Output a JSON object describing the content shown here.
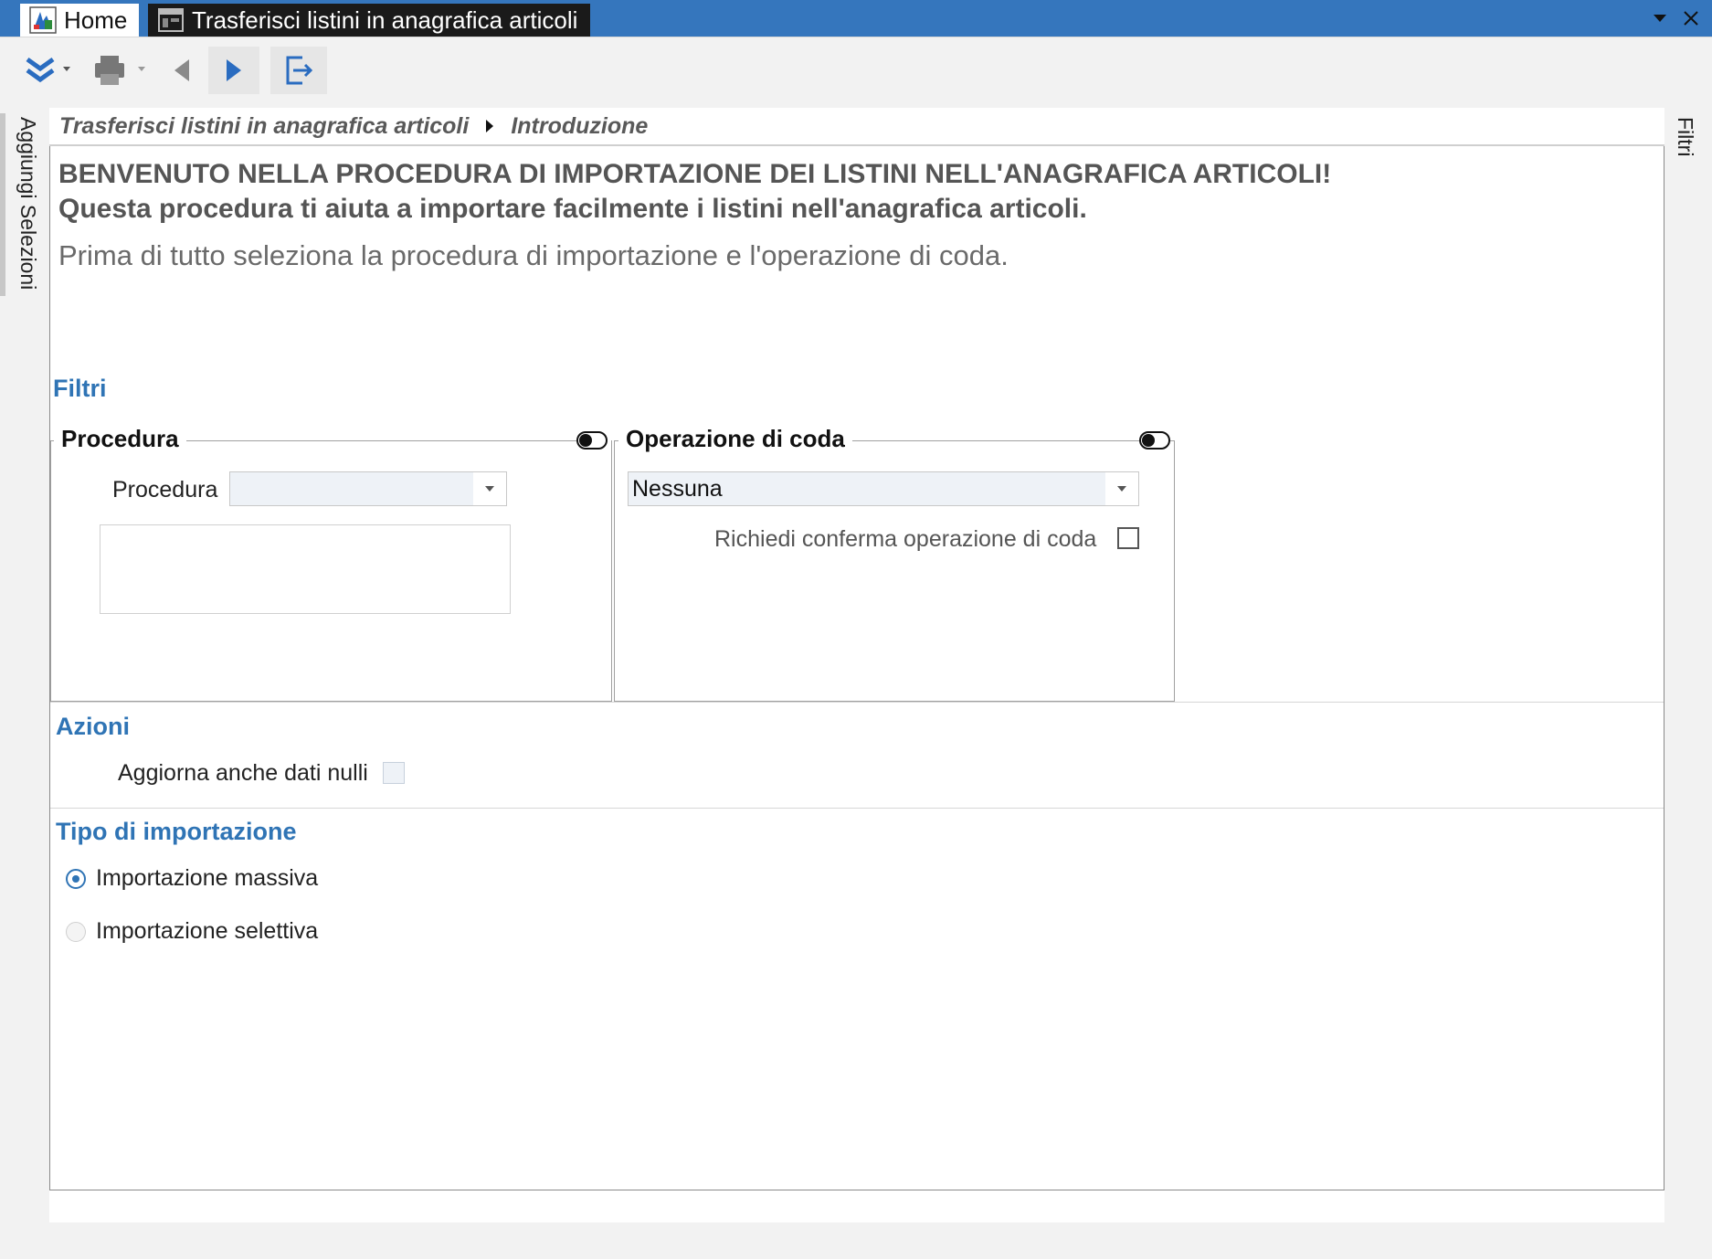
{
  "tabs": {
    "home_label": "Home",
    "doc_label": "Trasferisci listini in anagrafica articoli"
  },
  "toolbar": {
    "buttons": [
      "expand-icon",
      "print-icon",
      "back-icon",
      "forward-icon",
      "exit-icon"
    ]
  },
  "rails": {
    "left_label": "Aggiungi Selezioni",
    "right_label": "Filtri"
  },
  "breadcrumb": {
    "root": "Trasferisci listini in anagrafica articoli",
    "current": "Introduzione"
  },
  "intro": {
    "heading1": "BENVENUTO NELLA PROCEDURA DI IMPORTAZIONE DEI LISTINI NELL'ANAGRAFICA ARTICOLI!",
    "heading2": "Questa procedura ti aiuta a importare facilmente i listini nell'anagrafica articoli.",
    "text": "Prima di tutto seleziona la procedura di importazione e l'operazione di coda."
  },
  "filtri": {
    "title": "Filtri",
    "procedura_group": {
      "title": "Procedura",
      "field_label": "Procedura",
      "value": ""
    },
    "coda_group": {
      "title": "Operazione di coda",
      "value": "Nessuna",
      "confirm_label": "Richiedi conferma operazione di coda",
      "confirm_checked": false
    }
  },
  "azioni": {
    "title": "Azioni",
    "update_nulls_label": "Aggiorna anche dati nulli",
    "update_nulls_checked": false
  },
  "tipo": {
    "title": "Tipo di importazione",
    "options": [
      {
        "label": "Importazione massiva",
        "selected": true
      },
      {
        "label": "Importazione selettiva",
        "selected": false
      }
    ]
  },
  "colors": {
    "titlebar": "#3576bd",
    "section_title": "#2f74b5",
    "toolbar_icon_blue": "#2a6cc0"
  }
}
